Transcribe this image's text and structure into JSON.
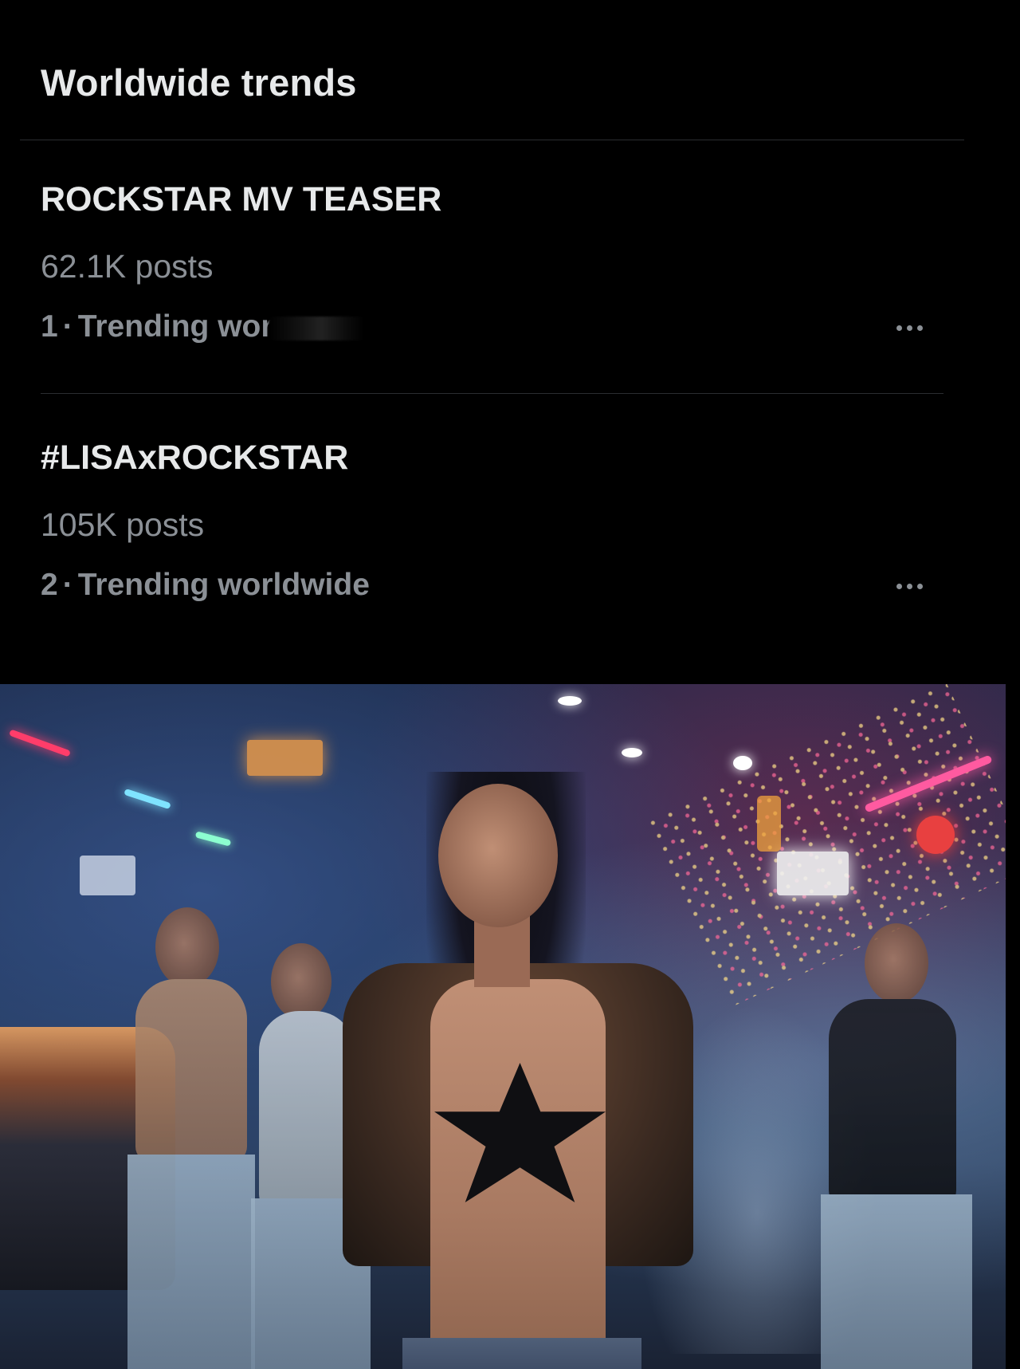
{
  "section": {
    "title": "Worldwide trends"
  },
  "trends": [
    {
      "name": "ROCKSTAR MV TEASER",
      "posts": "62.1K posts",
      "rank": "1",
      "separator": "·",
      "label": "Trending wor"
    },
    {
      "name": "#LISAxROCKSTAR",
      "posts": "105K posts",
      "rank": "2",
      "separator": "·",
      "label": "Trending worldwide"
    }
  ],
  "more_icon": "more-horizontal-icon",
  "colors": {
    "background": "#000000",
    "primary_text": "#e7e9ea",
    "secondary_text": "#8b9096",
    "divider": "#2a2d30"
  }
}
